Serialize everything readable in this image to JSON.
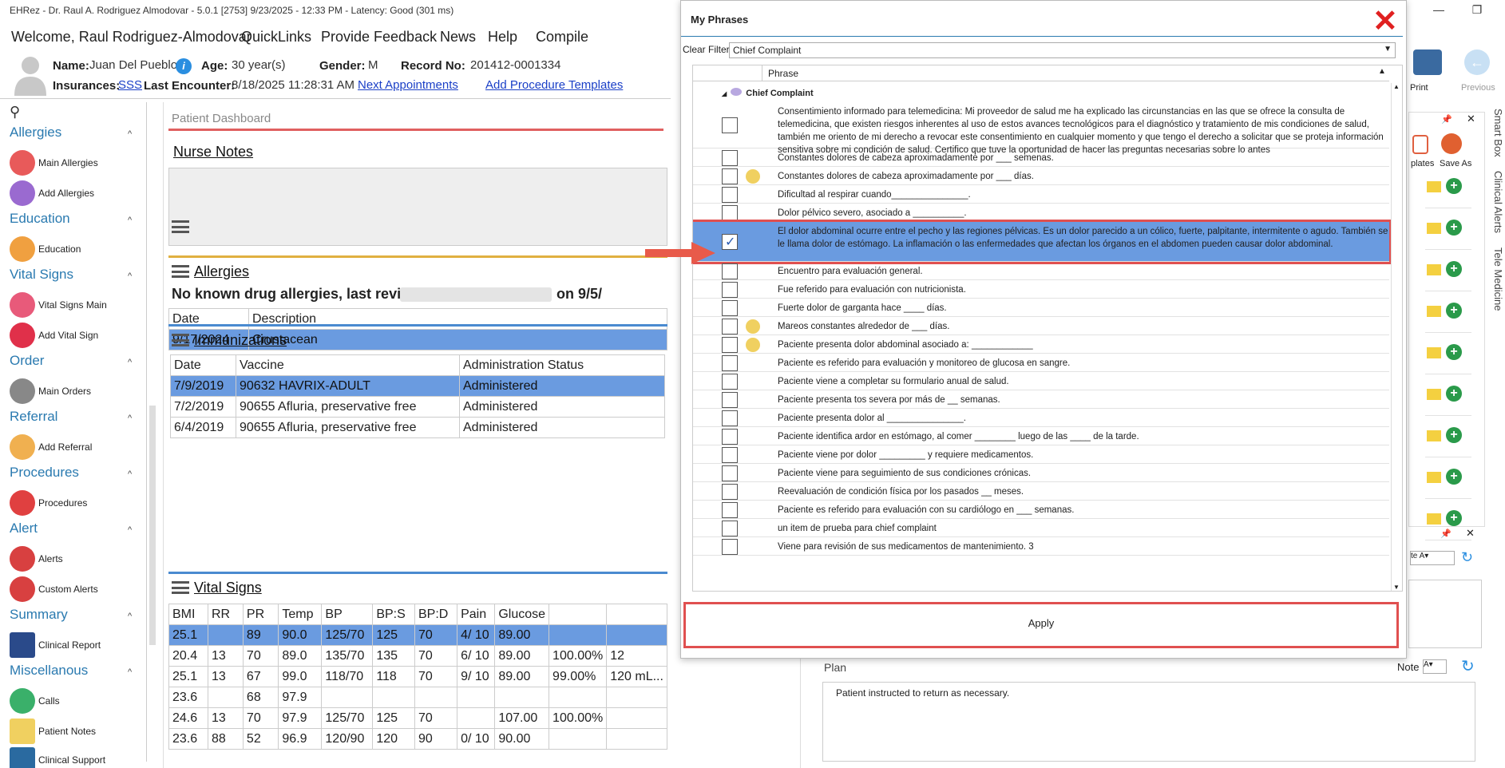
{
  "window": {
    "title": "EHRez - Dr. Raul A. Rodriguez Almodovar - 5.0.1 [2753] 9/23/2025 - 12:33 PM - Latency: Good (301 ms)"
  },
  "menu": [
    "Welcome, Raul Rodriguez-Almodovar",
    "QuickLinks",
    "Provide Feedback",
    "News",
    "Help",
    "Compile"
  ],
  "patient": {
    "name_label": "Name:",
    "name": "Juan Del Pueblo",
    "age_label": "Age:",
    "age": "30 year(s)",
    "gender_label": "Gender:",
    "gender": "M",
    "record_label": "Record No:",
    "record": "201412-0001334",
    "ins_label": "Insurances:",
    "insurance": "SSS",
    "last_label": "Last Encounter:",
    "last": "8/18/2025 11:28:31 AM",
    "next": "Next Appointments",
    "addproc": "Add Procedure Templates"
  },
  "toolbar": {
    "print": "Print",
    "previous": "Previous",
    "templates": "plates",
    "save_as": "Save As"
  },
  "sidebar": {
    "sections": [
      "Allergies",
      "Education",
      "Vital Signs",
      "Order",
      "Referral",
      "Procedures",
      "Alert",
      "Summary",
      "Miscellanous"
    ],
    "items": [
      "Main Allergies",
      "Add Allergies",
      "Education",
      "Vital Signs Main",
      "Add Vital Sign",
      "Main Orders",
      "Add Referral",
      "Procedures",
      "Alerts",
      "Custom Alerts",
      "Clinical Report",
      "Calls",
      "Patient Notes",
      "Clinical Support"
    ]
  },
  "dashboard": {
    "title": "Patient Dashboard",
    "nurse_notes": "Nurse Notes",
    "allergies": {
      "title": "Allergies",
      "summary_left": "No known drug allergies, last reviewed by",
      "summary_right": "on 9/5/",
      "cols": [
        "Date",
        "Description"
      ],
      "rows": [
        [
          "9/17/2024",
          "Crustacean"
        ]
      ]
    },
    "immunizations": {
      "title": "Immunizations",
      "cols": [
        "Date",
        "Vaccine",
        "Administration Status"
      ],
      "rows": [
        [
          "7/9/2019",
          "90632 HAVRIX-ADULT",
          "Administered"
        ],
        [
          "7/2/2019",
          "90655 Afluria, preservative free",
          "Administered"
        ],
        [
          "6/4/2019",
          "90655 Afluria, preservative free",
          "Administered"
        ]
      ]
    },
    "vitals": {
      "title": "Vital Signs",
      "cols": [
        "BMI",
        "RR",
        "PR",
        "Temp",
        "BP",
        "BP:S",
        "BP:D",
        "Pain",
        "Glucose",
        "",
        ""
      ],
      "rows": [
        [
          "25.1",
          "",
          "89",
          "90.0",
          "125/70",
          "125",
          "70",
          "4/ 10",
          "89.00",
          "",
          ""
        ],
        [
          "20.4",
          "13",
          "70",
          "89.0",
          "135/70",
          "135",
          "70",
          "6/ 10",
          "89.00",
          "100.00%",
          "12"
        ],
        [
          "25.1",
          "13",
          "67",
          "99.0",
          "118/70",
          "118",
          "70",
          "9/ 10",
          "89.00",
          "99.00%",
          "120 mL..."
        ],
        [
          "23.6",
          "",
          "68",
          "97.9",
          "",
          "",
          "",
          "",
          "",
          "",
          ""
        ],
        [
          "24.6",
          "13",
          "70",
          "97.9",
          "125/70",
          "125",
          "70",
          "",
          "107.00",
          "100.00%",
          ""
        ],
        [
          "23.6",
          "88",
          "52",
          "96.9",
          "120/90",
          "120",
          "90",
          "0/ 10",
          "90.00",
          "",
          ""
        ]
      ]
    }
  },
  "right": {
    "tabs": [
      "Smart Box",
      "Clinical Alerts",
      "Tele Medicine"
    ],
    "note": "Note",
    "plan_label": "Plan",
    "plan_text": "Patient instructed to return as necessary."
  },
  "modal": {
    "title": "My Phrases",
    "clear_filter": "Clear Filter",
    "filter_value": "Chief Complaint",
    "col_phrase": "Phrase",
    "group": "Chief Complaint",
    "apply": "Apply",
    "phrases": [
      "Consentimiento informado para telemedicina:  Mi proveedor de salud me ha explicado las circunstancias en las que se ofrece la consulta de telemedicina, que existen riesgos inherentes al uso de estos avances tecnológicos para el diagnóstico y tratamiento de mis condiciones de salud, también me oriento de mi derecho a revocar este consentimiento en cualquier momento y que tengo el derecho a solicitar que se proteja información sensitiva sobre mi condición de salud.  Certifico que tuve la oportunidad de hacer las preguntas necesarias sobre lo antes",
      "Constantes dolores de cabeza aproximadamente por ___ semenas.",
      "Constantes dolores de cabeza aproximadamente por ___ días.",
      "Dificultad al respirar cuando_______________.",
      "Dolor pélvico severo, asociado a __________.",
      "El dolor abdominal ocurre entre el pecho y las regiones pélvicas. Es un dolor parecido a un cólico, fuerte, palpitante, intermitente o agudo. También se le llama dolor de estómago. La inflamación o las enfermedades que afectan los órganos en el abdomen pueden causar dolor abdominal.",
      "Encuentro para evaluación general.",
      "Fue referido para evaluación con nutricionista.",
      "Fuerte dolor de garganta hace ____ días.",
      "Mareos constantes alrededor de ___ días.",
      "Paciente presenta dolor abdominal asociado a: ____________",
      "Paciente es referido para evaluación y monitoreo de glucosa en sangre.",
      "Paciente viene a completar su formulario anual de salud.",
      "Paciente presenta tos severa por más de __ semanas.",
      "Paciente presenta dolor al _______________.",
      "Paciente identifica ardor en estómago, al comer ________ luego de las ____ de la tarde.",
      "Paciente viene por dolor _________ y requiere medicamentos.",
      "Paciente viene para seguimiento de sus condiciones crónicas.",
      "Reevaluación de condición física por los pasados __ meses.",
      "Paciente es referido para evaluación con su cardiólogo en ___ semanas.",
      "un item de prueba para chief complaint",
      "Viene para revisión de sus medicamentos de mantenimiento. 3"
    ]
  },
  "colors": {
    "accent": "#2a7ab0",
    "selection": "#6a9be0",
    "highlight": "#e05050"
  }
}
